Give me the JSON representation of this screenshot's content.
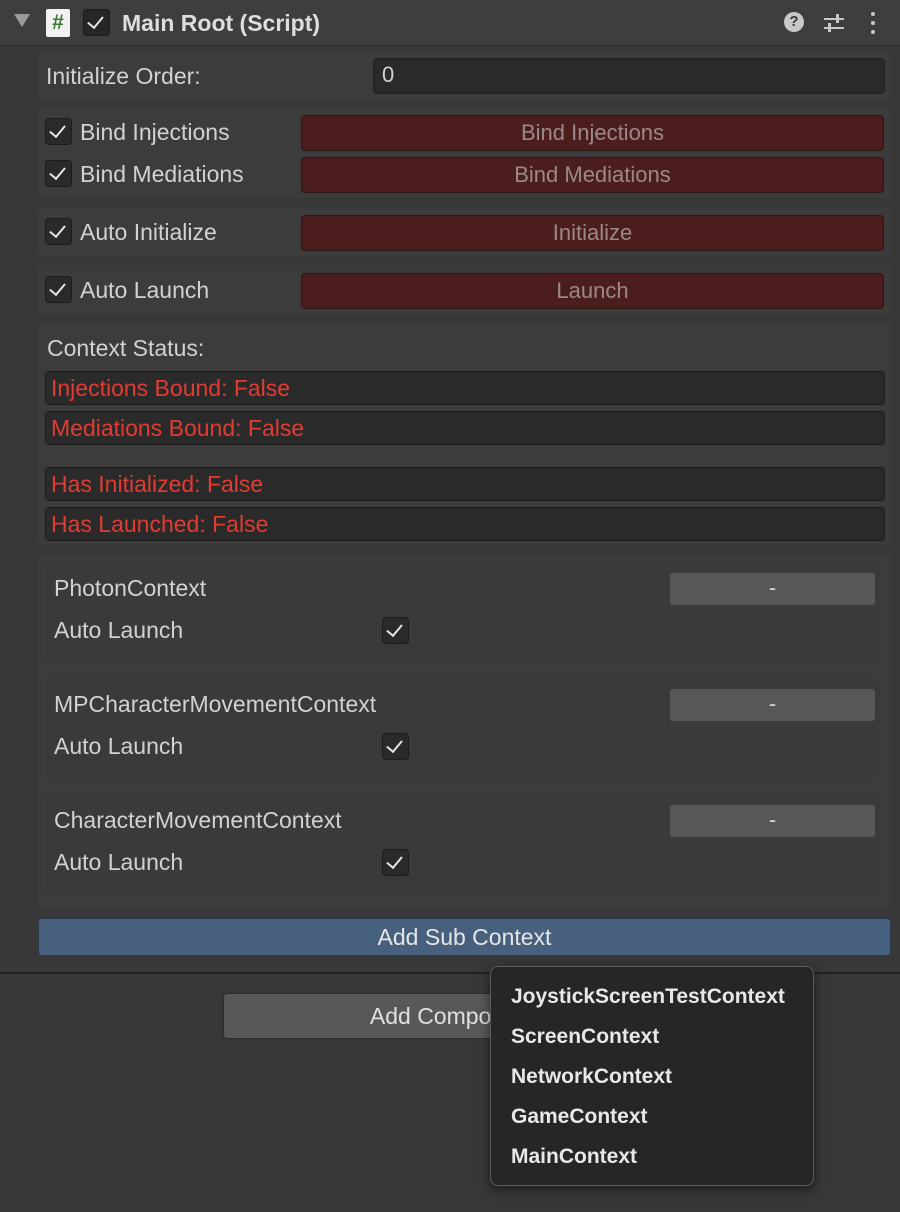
{
  "header": {
    "title": "Main Root (Script)",
    "script_icon": "#",
    "enabled": true
  },
  "initialize_order": {
    "label": "Initialize Order:",
    "value": "0"
  },
  "binds": [
    {
      "label": "Bind Injections",
      "checked": true,
      "button": "Bind Injections"
    },
    {
      "label": "Bind Mediations",
      "checked": true,
      "button": "Bind Mediations"
    },
    {
      "label": "Auto Initialize",
      "checked": true,
      "button": "Initialize"
    },
    {
      "label": "Auto Launch",
      "checked": true,
      "button": "Launch"
    }
  ],
  "status": {
    "title": "Context Status:",
    "items": [
      "Injections Bound: False",
      "Mediations Bound: False",
      "Has Initialized: False",
      "Has Launched: False"
    ],
    "color": "#e23c32"
  },
  "sub_contexts": [
    {
      "name": "PhotonContext",
      "auto_launch_label": "Auto Launch",
      "auto_launch": true,
      "remove_label": "-"
    },
    {
      "name": "MPCharacterMovementContext",
      "auto_launch_label": "Auto Launch",
      "auto_launch": true,
      "remove_label": "-"
    },
    {
      "name": "CharacterMovementContext",
      "auto_launch_label": "Auto Launch",
      "auto_launch": true,
      "remove_label": "-"
    }
  ],
  "add_sub_context": "Add Sub Context",
  "add_component": "Add Component",
  "dropdown": {
    "items": [
      "JoystickScreenTestContext",
      "ScreenContext",
      "NetworkContext",
      "GameContext",
      "MainContext"
    ]
  },
  "colors": {
    "button_red": "#4c1d1d",
    "accent_blue": "#46607e",
    "status_red": "#e23c32"
  }
}
